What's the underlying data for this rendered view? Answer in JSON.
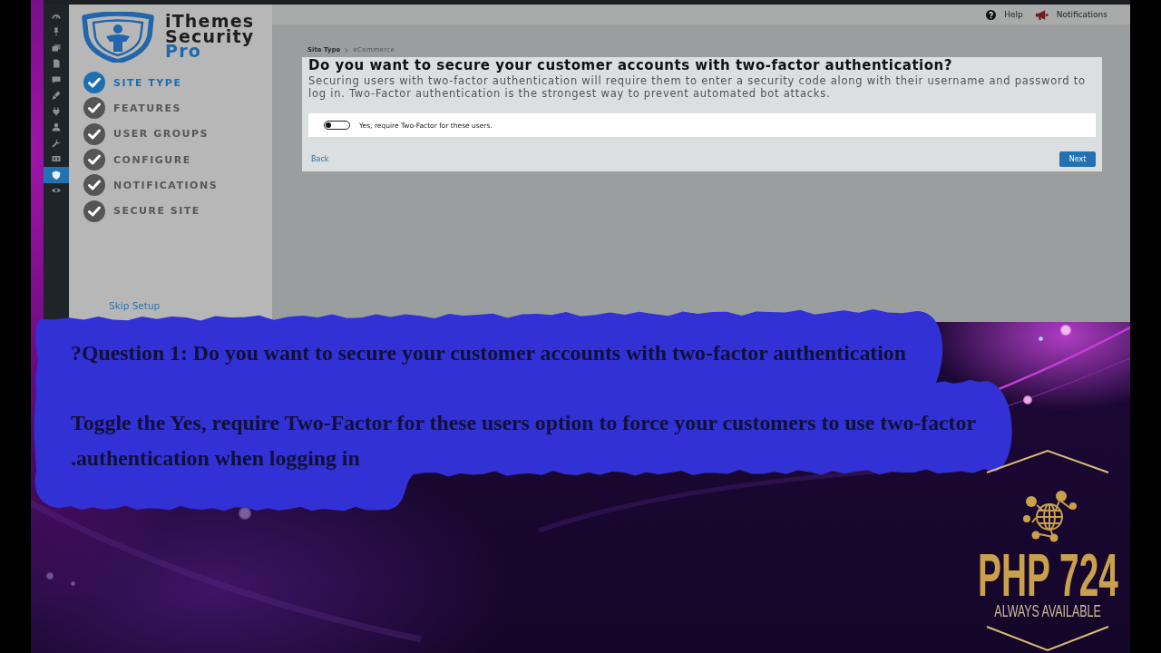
{
  "admin_menu": [
    {
      "selected": false
    },
    {
      "selected": false
    },
    {
      "selected": false
    },
    {
      "selected": false
    },
    {
      "selected": false
    },
    {
      "selected": false
    },
    {
      "selected": false
    },
    {
      "selected": false
    },
    {
      "selected": false
    },
    {
      "selected": false
    },
    {
      "selected": true
    },
    {
      "selected": false
    }
  ],
  "wizard": {
    "brand": {
      "name": "iThemes Security",
      "edition": "Pro"
    },
    "steps": [
      {
        "label": "SITE TYPE",
        "selected": true
      },
      {
        "label": "FEATURES",
        "selected": false
      },
      {
        "label": "USER GROUPS",
        "selected": false
      },
      {
        "label": "CONFIGURE",
        "selected": false
      },
      {
        "label": "NOTIFICATIONS",
        "selected": false
      },
      {
        "label": "SECURE SITE",
        "selected": false
      }
    ],
    "skip_link": "Skip Setup"
  },
  "header": {
    "help": "Help",
    "notifications": "Notifications"
  },
  "breadcrumb": [
    "Site Type",
    "eCommerce"
  ],
  "card": {
    "title": "Do you want to secure your customer accounts with two-factor authentication?",
    "description": "Securing users with two-factor authentication will require them to enter a security code along with their username and password to log in. Two-Factor authentication is the strongest way to prevent automated bot attacks.",
    "toggle": {
      "label": "Yes, require Two-Factor for these users.",
      "on": false
    },
    "back": "Back",
    "next": "Next"
  },
  "captions": [
    "?Question 1: Do you want to secure your customer accounts with two-factor authentication",
    "Toggle the Yes, require Two-Factor for these users option to force your customers to use two-factor .authentication when logging in"
  ],
  "logo": {
    "name": "PHP 724",
    "tagline": "ALWAYS AVAILABLE"
  }
}
